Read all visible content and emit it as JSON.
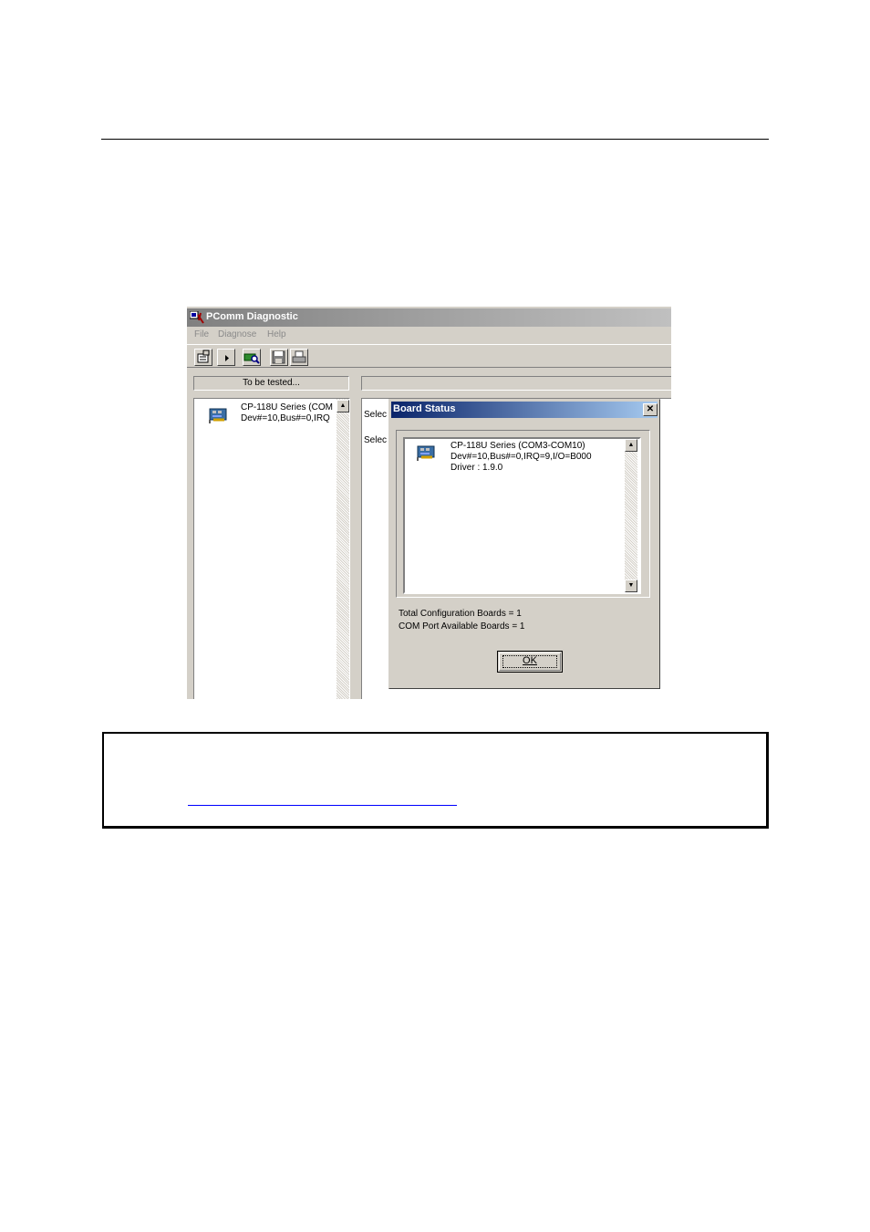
{
  "window": {
    "title": "PComm Diagnostic"
  },
  "menu": [
    "File",
    "Diagnose",
    "Help"
  ],
  "left_panel": {
    "header": "To be tested...",
    "item_line1": "CP-118U Series  (COM",
    "item_line2": "Dev#=10,Bus#=0,IRQ"
  },
  "right_panel": {
    "line1": "Selec",
    "line2": "Selec"
  },
  "dialog": {
    "title": "Board Status",
    "close_label": "✕",
    "item_line1": "CP-118U Series  (COM3-COM10)",
    "item_line2": "Dev#=10,Bus#=0,IRQ=9,I/O=B000",
    "item_line3": "Driver : 1.9.0",
    "total_boards": "Total Configuration Boards = 1",
    "available_boards": "COM Port Available Boards = 1",
    "ok_label": "OK"
  },
  "icons": [
    "app-icon",
    "properties-icon",
    "run-icon",
    "board-search-icon",
    "save-icon",
    "print-icon",
    "pci-board-icon"
  ],
  "colors": {
    "dialog_title_start": "#0a246a",
    "dialog_title_end": "#a6caf0",
    "inactive_title": "#808080",
    "window_face": "#d4d0c8",
    "link": "#0000ff"
  }
}
